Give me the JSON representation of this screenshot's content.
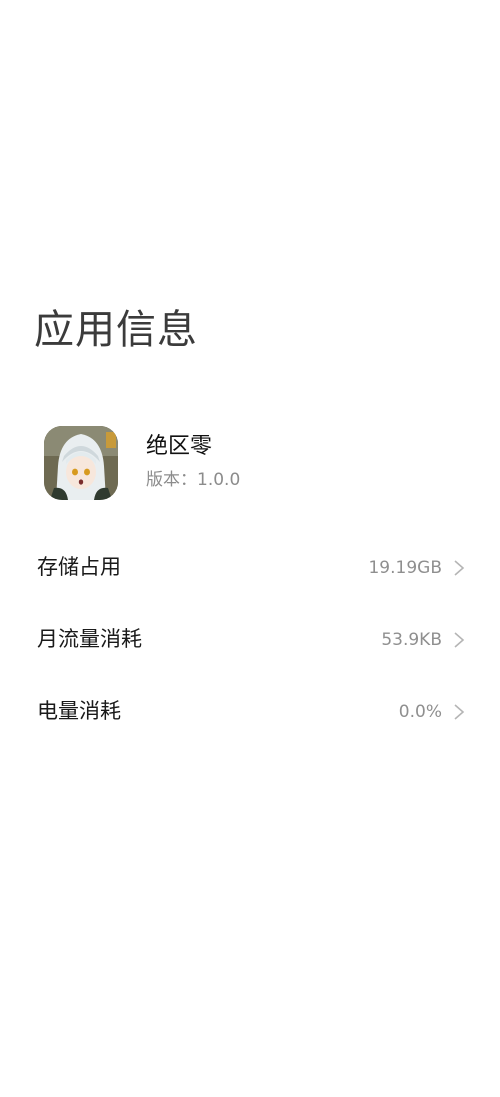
{
  "page": {
    "title": "应用信息"
  },
  "app": {
    "name": "绝区零",
    "version": "版本：1.0.0",
    "icon": "app-icon-anime-character"
  },
  "settings": [
    {
      "label": "存储占用",
      "value": "19.19GB",
      "icon": "chevron-right-icon"
    },
    {
      "label": "月流量消耗",
      "value": "53.9KB",
      "icon": "chevron-right-icon"
    },
    {
      "label": "电量消耗",
      "value": "0.0%",
      "icon": "chevron-right-icon"
    }
  ],
  "colors": {
    "background": "#ffffff",
    "title": "#3b3b3b",
    "label": "#1a1a1a",
    "value": "#8f8f8f",
    "chevron": "#b5b5b5"
  }
}
